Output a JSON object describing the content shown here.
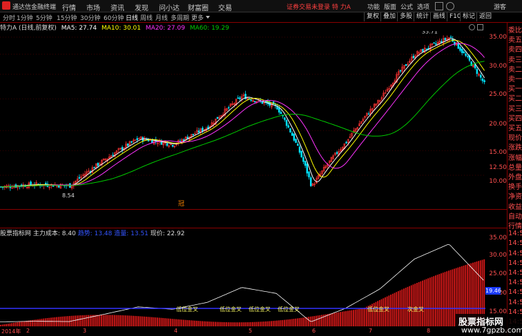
{
  "topbar": {
    "app_title": "通达信金融终端",
    "menus": [
      "行情",
      "市场",
      "资讯",
      "发现",
      "问小达",
      "财富圈",
      "交易"
    ],
    "alert": "证券交易未登录  特 力A",
    "right_menus": [
      "功能",
      "版面",
      "公式",
      "选项",
      "游客"
    ]
  },
  "periodbar": {
    "tabs": [
      "分时",
      "1分钟",
      "5分钟",
      "15分钟",
      "30分钟",
      "60分钟",
      "日线",
      "周线",
      "月线",
      "多周期",
      "更多"
    ],
    "active": "日线",
    "tools": [
      "复权",
      "叠加",
      "多股",
      "统计",
      "画线",
      "F10",
      "标记",
      "返回"
    ]
  },
  "maline": {
    "stock": "特力A (日线,前复权)",
    "ma5": "MA5: 27.74",
    "ma10": "MA10: 30.01",
    "ma20": "MA20: 27.09",
    "ma60": "MA60: 19.29"
  },
  "main_chart": {
    "high_label": "35.71",
    "low_label": "8.54",
    "price_axis": [
      "35.00",
      "30.00",
      "25.00",
      "20.00",
      "15.00",
      "12.50",
      "10.00"
    ],
    "marker": "冠"
  },
  "sub_chart": {
    "indicator": "股票指标网",
    "cost_label": "主力成本: 8.40",
    "blue1": "趋势: 13.48",
    "blue2": "造量: 13.51",
    "price_label": "现价: 22.92",
    "axis": [
      "35.00",
      "30.00",
      "25.00",
      "20.00",
      "15.00"
    ],
    "current_tag": "19.46",
    "annotations": [
      "低位金叉",
      "低位金叉",
      "低位金叉",
      "低位金叉",
      "低位金叉",
      "次金叉"
    ]
  },
  "xaxis": {
    "labels": [
      "2014年",
      "2",
      "3",
      "4",
      "5",
      "6",
      "7",
      "8"
    ]
  },
  "sidebar": {
    "items": [
      "委比",
      "卖五",
      "卖四",
      "卖三",
      "卖二",
      "卖一",
      "买一",
      "买二",
      "买三",
      "买四",
      "买五",
      "现价",
      "涨跌",
      "涨幅",
      "总量",
      "外盘",
      "换手",
      "净资",
      "收益",
      "自动",
      "行情",
      "14:50",
      "14:50",
      "14:50",
      "14:50",
      "14:50",
      "14:50",
      "14:50",
      "14:50",
      "14:50",
      "14:50"
    ]
  },
  "watermark": {
    "line1": "股票指标网",
    "line2": "www.7gpzb.com"
  },
  "colors": {
    "up": "#ff3333",
    "down": "#00e5ff",
    "ma5": "#ffffff",
    "ma10": "#ffff00",
    "ma20": "#ff33ff",
    "ma60": "#00cc00",
    "blue": "#3333ff"
  },
  "chart_data": {
    "type": "candlestick",
    "x": [
      "2014-01",
      "2014-02",
      "2014-03",
      "2014-04",
      "2014-05",
      "2014-06",
      "2014-07",
      "2014-08"
    ],
    "close_trend": [
      9.0,
      9.2,
      9.1,
      11.5,
      14.0,
      13.2,
      15.5,
      20.5,
      18.5,
      9.0,
      13.5,
      20.0,
      30.0,
      35.0,
      22.9
    ],
    "ylim": [
      7.5,
      37
    ]
  }
}
